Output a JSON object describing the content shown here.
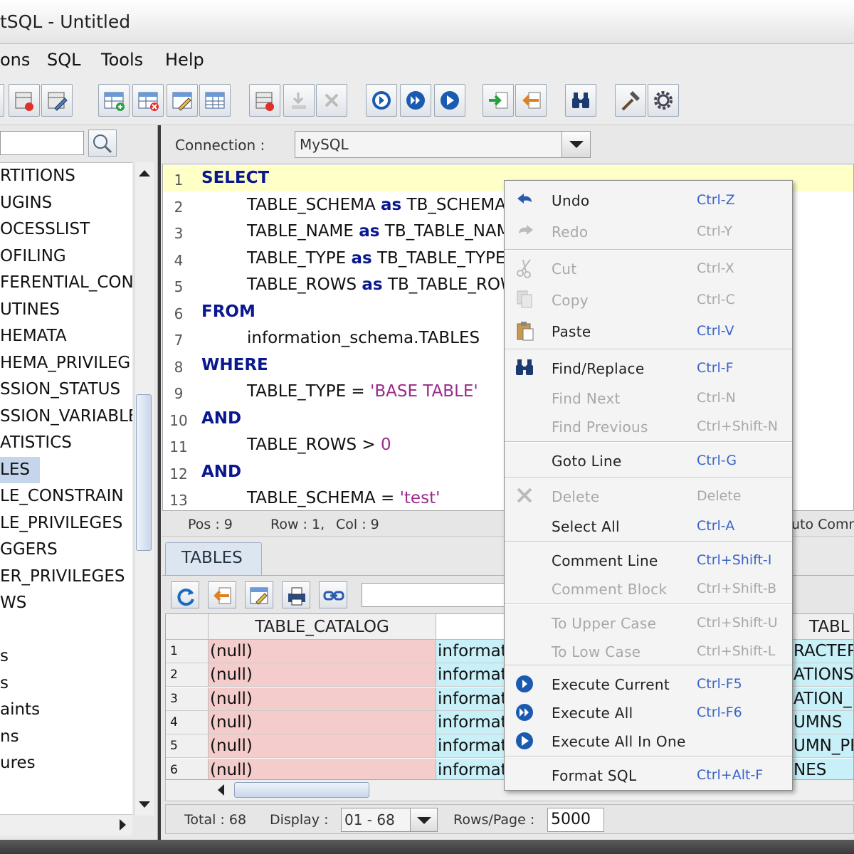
{
  "window": {
    "title": "tSQL - Untitled"
  },
  "menu": [
    "ons",
    "SQL",
    "Tools",
    "Help"
  ],
  "toolbar_icons": [
    "db-remove-icon",
    "db-edit-icon",
    "table-add-icon",
    "table-remove-icon",
    "table-edit-icon",
    "table-icon",
    "db-stop-icon",
    "import-icon",
    "clear-icon",
    "execute-current-icon",
    "execute-all-icon",
    "execute-all-in-one-icon",
    "export-icon",
    "import-back-icon",
    "binoculars-icon",
    "hammer-icon",
    "gear-icon"
  ],
  "tree": {
    "items": [
      "RTITIONS",
      "UGINS",
      "OCESSLIST",
      "OFILING",
      "FERENTIAL_CON",
      "UTINES",
      "HEMATA",
      "HEMA_PRIVILEG",
      "SSION_STATUS",
      "SSION_VARIABLE",
      "ATISTICS",
      "LES",
      "LE_CONSTRAIN",
      "LE_PRIVILEGES",
      "GGERS",
      "ER_PRIVILEGES",
      "WS",
      "",
      "s",
      "s",
      "aints",
      "ns",
      "ures"
    ],
    "selected_index": 11
  },
  "connection": {
    "label": "Connection :",
    "value": "MySQL"
  },
  "editor": {
    "line_numbers": [
      "1",
      "2",
      "3",
      "4",
      "5",
      "6",
      "7",
      "8",
      "9",
      "10",
      "11",
      "12",
      "13"
    ],
    "lines": [
      [
        {
          "t": "SELECT",
          "k": "kw"
        }
      ],
      [
        {
          "t": "TABLE_SCHEMA ",
          "k": ""
        },
        {
          "t": "as",
          "k": "kw"
        },
        {
          "t": " TB_SCHEMA",
          "k": ""
        }
      ],
      [
        {
          "t": "TABLE_NAME ",
          "k": ""
        },
        {
          "t": "as",
          "k": "kw"
        },
        {
          "t": " TB_TABLE_NAME",
          "k": ""
        }
      ],
      [
        {
          "t": "TABLE_TYPE ",
          "k": ""
        },
        {
          "t": "as",
          "k": "kw"
        },
        {
          "t": " TB_TABLE_TYPE",
          "k": ""
        }
      ],
      [
        {
          "t": "TABLE_ROWS ",
          "k": ""
        },
        {
          "t": "as",
          "k": "kw"
        },
        {
          "t": " TB_TABLE_ROWS",
          "k": ""
        }
      ],
      [
        {
          "t": "FROM",
          "k": "kw"
        }
      ],
      [
        {
          "t": "information_schema.TABLES",
          "k": ""
        }
      ],
      [
        {
          "t": "WHERE",
          "k": "kw"
        }
      ],
      [
        {
          "t": "TABLE_TYPE = ",
          "k": ""
        },
        {
          "t": "'BASE TABLE'",
          "k": "str"
        }
      ],
      [
        {
          "t": "AND",
          "k": "kw"
        }
      ],
      [
        {
          "t": "TABLE_ROWS > ",
          "k": ""
        },
        {
          "t": "0",
          "k": "num"
        }
      ],
      [
        {
          "t": "AND",
          "k": "kw"
        }
      ],
      [
        {
          "t": "TABLE_SCHEMA = ",
          "k": ""
        },
        {
          "t": "'test'",
          "k": "str"
        }
      ]
    ],
    "indented": [
      false,
      true,
      true,
      true,
      true,
      false,
      true,
      false,
      true,
      false,
      true,
      false,
      true
    ]
  },
  "status": {
    "pos": "Pos : 9",
    "row": "Row : 1,",
    "col": "Col : 9",
    "right": "uto Commi"
  },
  "results": {
    "tab": "TABLES",
    "columns": [
      "",
      "TABLE_CATALOG",
      "informat",
      "",
      "TABL"
    ],
    "rows": [
      [
        "1",
        "(null)",
        "informat",
        "RACTER"
      ],
      [
        "2",
        "(null)",
        "informat",
        "ATIONS"
      ],
      [
        "3",
        "(null)",
        "informat",
        "ATION_"
      ],
      [
        "4",
        "(null)",
        "informat",
        "UMNS"
      ],
      [
        "5",
        "(null)",
        "informat",
        "UMN_PR"
      ],
      [
        "6",
        "(null)",
        "informat",
        "NES"
      ]
    ],
    "footer": {
      "total": "Total : 68",
      "display_label": "Display :",
      "display_value": "01 - 68",
      "rows_label": "Rows/Page :",
      "rows_value": "5000"
    }
  },
  "context_menu": {
    "items": [
      {
        "label": "Undo",
        "shortcut": "Ctrl-Z",
        "enabled": true,
        "icon": "undo-icon"
      },
      {
        "label": "Redo",
        "shortcut": "Ctrl-Y",
        "enabled": false,
        "icon": "redo-icon"
      },
      {
        "label": "Cut",
        "shortcut": "Ctrl-X",
        "enabled": false,
        "icon": "cut-icon"
      },
      {
        "label": "Copy",
        "shortcut": "Ctrl-C",
        "enabled": false,
        "icon": "copy-icon"
      },
      {
        "label": "Paste",
        "shortcut": "Ctrl-V",
        "enabled": true,
        "icon": "paste-icon"
      },
      {
        "label": "Find/Replace",
        "shortcut": "Ctrl-F",
        "enabled": true,
        "icon": "binoculars-icon"
      },
      {
        "label": "Find Next",
        "shortcut": "Ctrl-N",
        "enabled": false,
        "icon": ""
      },
      {
        "label": "Find Previous",
        "shortcut": "Ctrl+Shift-N",
        "enabled": false,
        "icon": ""
      },
      {
        "label": "Goto Line",
        "shortcut": "Ctrl-G",
        "enabled": true,
        "icon": ""
      },
      {
        "label": "Delete",
        "shortcut": "Delete",
        "enabled": false,
        "icon": "delete-icon"
      },
      {
        "label": "Select All",
        "shortcut": "Ctrl-A",
        "enabled": true,
        "icon": ""
      },
      {
        "label": "Comment Line",
        "shortcut": "Ctrl+Shift-I",
        "enabled": true,
        "icon": ""
      },
      {
        "label": "Comment Block",
        "shortcut": "Ctrl+Shift-B",
        "enabled": false,
        "icon": ""
      },
      {
        "label": "To Upper Case",
        "shortcut": "Ctrl+Shift-U",
        "enabled": false,
        "icon": ""
      },
      {
        "label": "To Low Case",
        "shortcut": "Ctrl+Shift-L",
        "enabled": false,
        "icon": ""
      },
      {
        "label": "Execute Current",
        "shortcut": "Ctrl-F5",
        "enabled": true,
        "icon": "execute-current-icon"
      },
      {
        "label": "Execute All",
        "shortcut": "Ctrl-F6",
        "enabled": true,
        "icon": "execute-all-icon"
      },
      {
        "label": "Execute All In One",
        "shortcut": "",
        "enabled": true,
        "icon": "execute-all-in-one-icon"
      },
      {
        "label": "Format SQL",
        "shortcut": "Ctrl+Alt-F",
        "enabled": true,
        "icon": ""
      }
    ]
  },
  "colors": {
    "keyword": "#0a1890",
    "string": "#9a2a8a",
    "shortcut": "#3a64c8",
    "null_cell": "#f4cccc",
    "info_cell": "#c8f0f8",
    "current_line": "#ffffc8"
  }
}
